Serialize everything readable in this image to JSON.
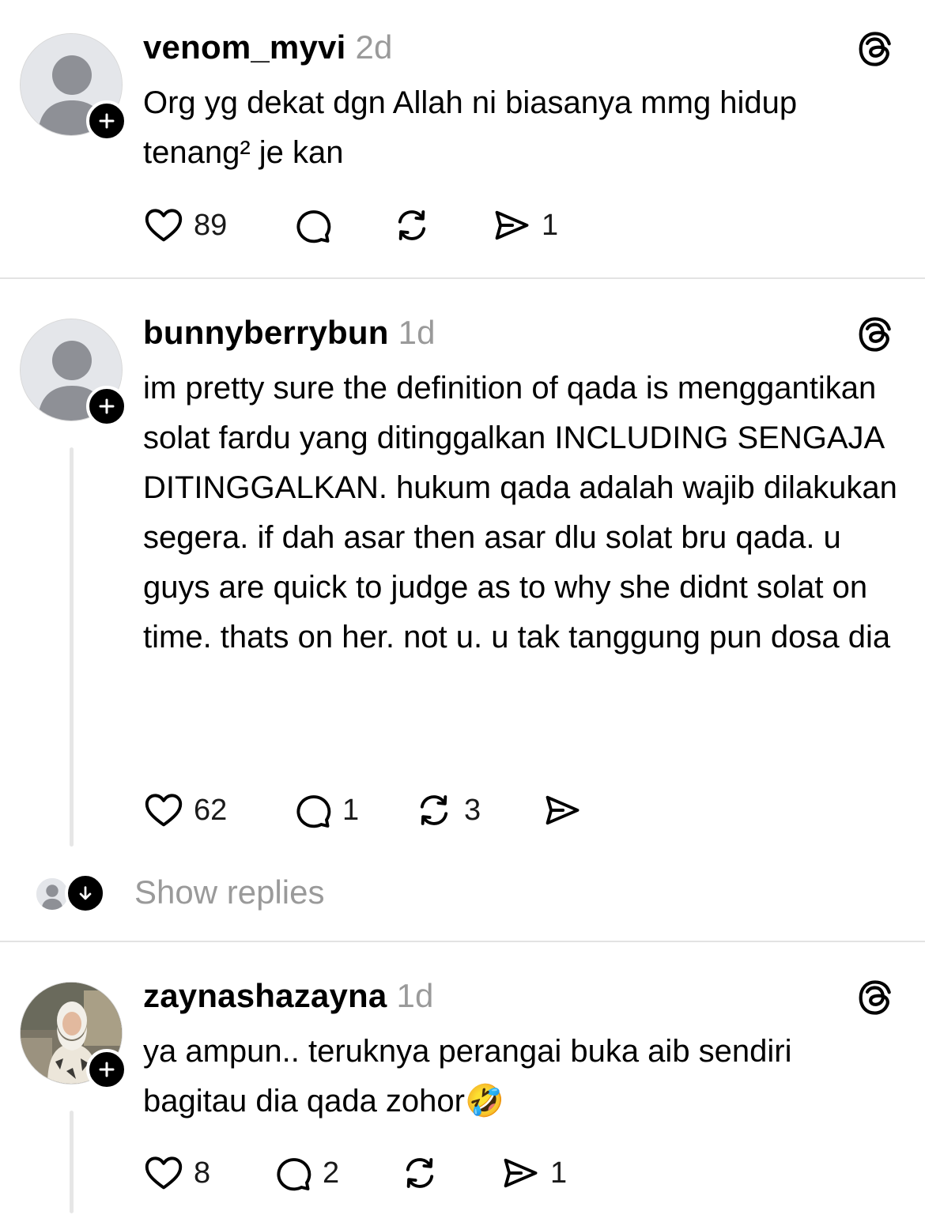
{
  "posts": [
    {
      "username": "venom_myvi",
      "time": "2d",
      "text": "Org yg dekat dgn Allah ni biasanya mmg hidup tenang² je kan",
      "likes": "89",
      "replies": "",
      "reposts": "",
      "shares": "1",
      "avatar": "default-avatar-icon"
    },
    {
      "username": "bunnyberrybun",
      "time": "1d",
      "text": "im pretty sure the definition of qada is menggantikan solat fardu yang ditinggalkan INCLUDING SENGAJA DITINGGALKAN. hukum qada adalah wajib dilakukan segera. if dah asar then asar dlu solat bru qada. u guys are quick to judge as to why she didnt solat on time. thats on her. not u. u tak tanggung pun dosa dia",
      "likes": "62",
      "replies": "1",
      "reposts": "3",
      "shares": "",
      "avatar": "default-avatar-icon"
    },
    {
      "username": "zaynashazayna",
      "time": "1d",
      "text": "ya ampun.. teruknya perangai buka aib sendiri bagitau dia qada zohor",
      "emoji": "🤣",
      "likes": "8",
      "replies": "2",
      "reposts": "",
      "shares": "1",
      "avatar": "profile-photo"
    }
  ],
  "show_replies_label": "Show replies",
  "colors": {
    "muted": "#9a9a9a",
    "divider": "#e3e3e3",
    "avatar_bg": "#e4e6ea"
  }
}
